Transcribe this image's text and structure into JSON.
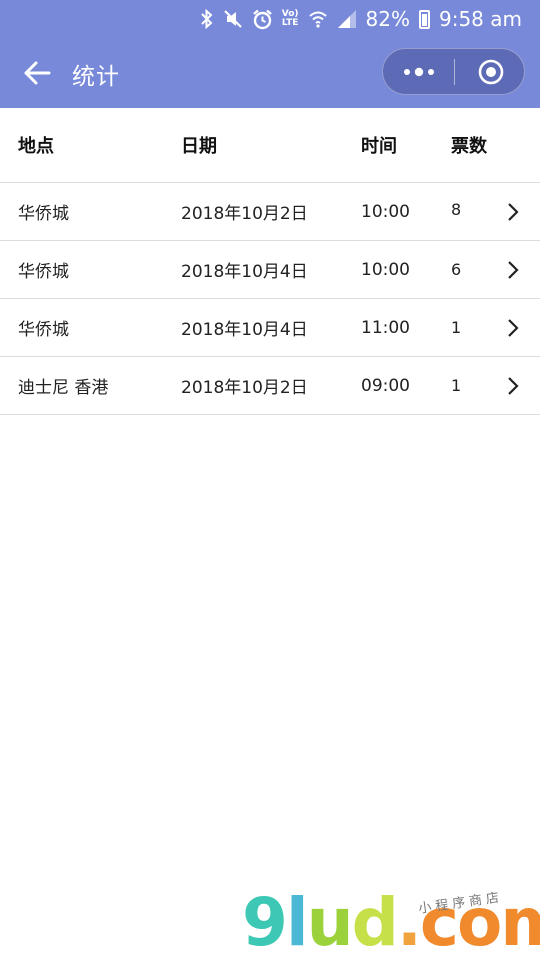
{
  "status_bar": {
    "lte_top": "Vo)",
    "lte_bottom": "LTE",
    "battery_text": "82%",
    "time": "9:58 am",
    "icons": [
      "bluetooth-icon",
      "mute-icon",
      "alarm-icon",
      "wifi-icon",
      "signal-icon",
      "battery-icon"
    ]
  },
  "navbar": {
    "title": "统计",
    "back_icon": "arrow-left-icon",
    "more_icon": "more-dots-icon",
    "close_icon": "target-circle-icon",
    "background": "#7889d9"
  },
  "table": {
    "headers": [
      "地点",
      "日期",
      "时间",
      "票数"
    ],
    "rows": [
      {
        "place": "华侨城",
        "date": "2018年10月2日",
        "time": "10:00",
        "tickets": "8"
      },
      {
        "place": "华侨城",
        "date": "2018年10月4日",
        "time": "10:00",
        "tickets": "6"
      },
      {
        "place": "华侨城",
        "date": "2018年10月4日",
        "time": "11:00",
        "tickets": "1"
      },
      {
        "place": "迪士尼 香港",
        "date": "2018年10月2日",
        "time": "09:00",
        "tickets": "1"
      }
    ],
    "row_icon": "chevron-right-icon"
  },
  "watermark": {
    "g": "9",
    "l": "l",
    "u": "u",
    "d": "d",
    "dot": ".",
    "com": "com",
    "sub": "小程序商店"
  }
}
